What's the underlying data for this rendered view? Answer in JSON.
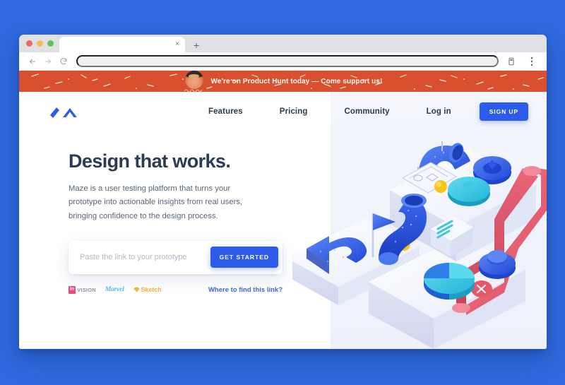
{
  "page": {
    "background_color": "#2f6ae0"
  },
  "browser": {
    "tab": {
      "title": "",
      "close_label": "×"
    },
    "new_tab_label": "+",
    "url_value": "",
    "url_placeholder": "",
    "controls": {
      "back": "back-arrow",
      "forward": "forward-arrow",
      "reload": "reload-icon",
      "profile": "profile-icon",
      "menu": "three-dot-menu-icon"
    },
    "traffic_lights": [
      "#ec6a5f",
      "#f5bd4f",
      "#61c554"
    ]
  },
  "banner": {
    "text": "We're on Product Hunt today — Come support us!",
    "background_color": "#d9502e",
    "text_color": "#ffffff",
    "avatar_name": "product-hunt-avatar"
  },
  "nav": {
    "logo_name": "maze-logo",
    "links": [
      {
        "label": "Features"
      },
      {
        "label": "Pricing"
      },
      {
        "label": "Community"
      },
      {
        "label": "Log in"
      }
    ],
    "signup_label": "SIGN UP",
    "accent_color": "#2d5bea"
  },
  "hero": {
    "headline": "Design that works.",
    "subcopy": "Maze is a user testing platform that turns your prototype into actionable insights from real users, bringing confidence to the design process.",
    "input_placeholder": "Paste the link to your prototype",
    "input_value": "",
    "cta_label": "GET STARTED",
    "find_link_label": "Where to find this link?",
    "brands": [
      {
        "name": "invision",
        "mark": "In",
        "word": "VISION",
        "color": "#ef4877"
      },
      {
        "name": "marvel",
        "word": "Marvel",
        "color": "#4fb8f0"
      },
      {
        "name": "sketch",
        "word": "Sketch",
        "color": "#f2b23e"
      }
    ]
  },
  "illustration": {
    "name": "isometric-3d-scene",
    "description": "Isometric 3D scene with white platforms, blue tubes, red pipe, flag, arrow and chart shapes",
    "palette": [
      "#2d5bea",
      "#3ec6e0",
      "#e8566a",
      "#f5c518",
      "#eef1fa"
    ]
  }
}
